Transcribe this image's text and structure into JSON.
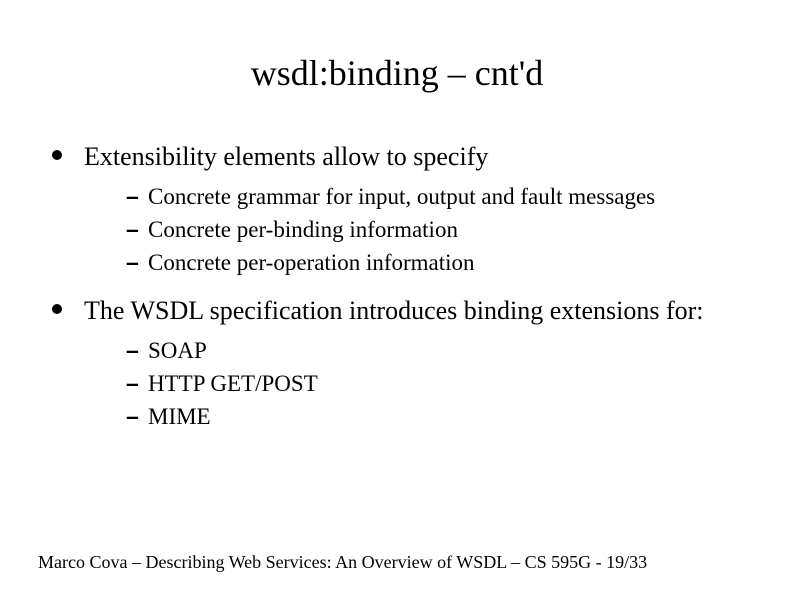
{
  "title": "wsdl:binding – cnt'd",
  "bullets": [
    {
      "text": "Extensibility elements allow to specify",
      "sub": [
        "Concrete grammar for input, output and fault messages",
        "Concrete per-binding information",
        "Concrete per-operation information"
      ]
    },
    {
      "text": "The WSDL specification introduces binding extensions for:",
      "sub": [
        "SOAP",
        "HTTP GET/POST",
        "MIME"
      ]
    }
  ],
  "footer": "Marco Cova – Describing Web Services: An Overview of WSDL – CS 595G -  19/33"
}
